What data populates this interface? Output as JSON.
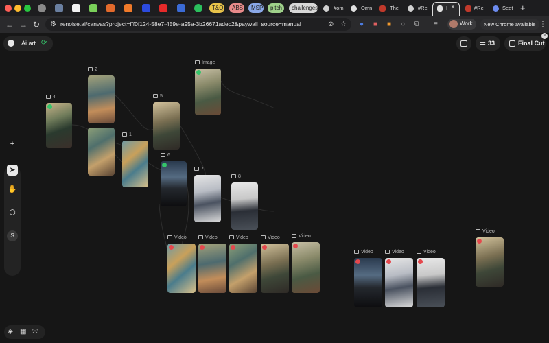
{
  "browser": {
    "url": "renoise.ai/canvas?project=fff0f124-58e7-459e-a95a-3b26671adec2&paywall_source=manual",
    "tabs": {
      "pill_tq": "T&Q",
      "pill_abs": "ABS",
      "pill_msp": "MSP",
      "pill_pitch": "pitch",
      "pill_challenges": "challenges",
      "tab_om": "#om",
      "tab_omn": "Omn",
      "tab_the": "The",
      "tab_re1": "#Re",
      "tab_active": "I",
      "tab_re2": "#Re",
      "tab_seet": "Seet"
    },
    "profile_label": "Work",
    "update_label": "New Chrome available"
  },
  "app": {
    "project_name": "Ai art",
    "count": "33",
    "final_cut_label": "Final Cut",
    "sidebar_s_label": "S"
  },
  "nodes": {
    "n4": "4",
    "n2": "2",
    "n1": "1",
    "n5": "5",
    "n_image": "Image",
    "n6": "6",
    "n7": "7",
    "n8": "8",
    "v1": "Video",
    "v2": "Video",
    "v3": "Video",
    "v4": "Video",
    "v5": "Video",
    "v6": "Video",
    "v7": "Video",
    "v8": "Video",
    "v9": "Video"
  }
}
